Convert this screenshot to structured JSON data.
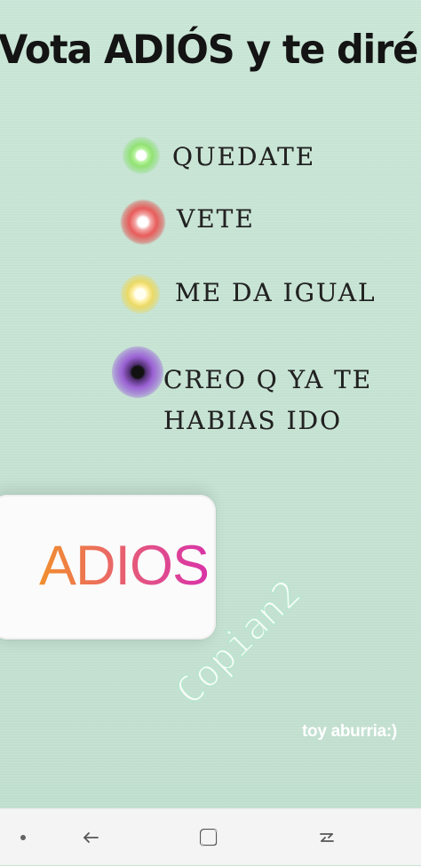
{
  "story": {
    "title": "Vota ADIÓS y te diré",
    "options": [
      {
        "label": "QUEDATE",
        "color": "#8ede73"
      },
      {
        "label": "VETE",
        "color": "#e85b5a"
      },
      {
        "label": "ME DA IGUAL",
        "color": "#ead965"
      },
      {
        "label": "CREO Q YA TE\nHABIAS IDO",
        "color": "#9a60d3"
      }
    ],
    "sticker_label": "ADIOS",
    "watermark": "Copian2",
    "caption": "toy aburria:)"
  },
  "navbar": {
    "icons": [
      "menu-dot-icon",
      "back-arrow-icon",
      "home-square-icon",
      "recent-apps-icon"
    ]
  },
  "colors": {
    "background": "#c6e5d4",
    "sticker_gradient_start": "#f08f2d",
    "sticker_gradient_end": "#d833a8",
    "navbar": "#f4f4f4"
  }
}
